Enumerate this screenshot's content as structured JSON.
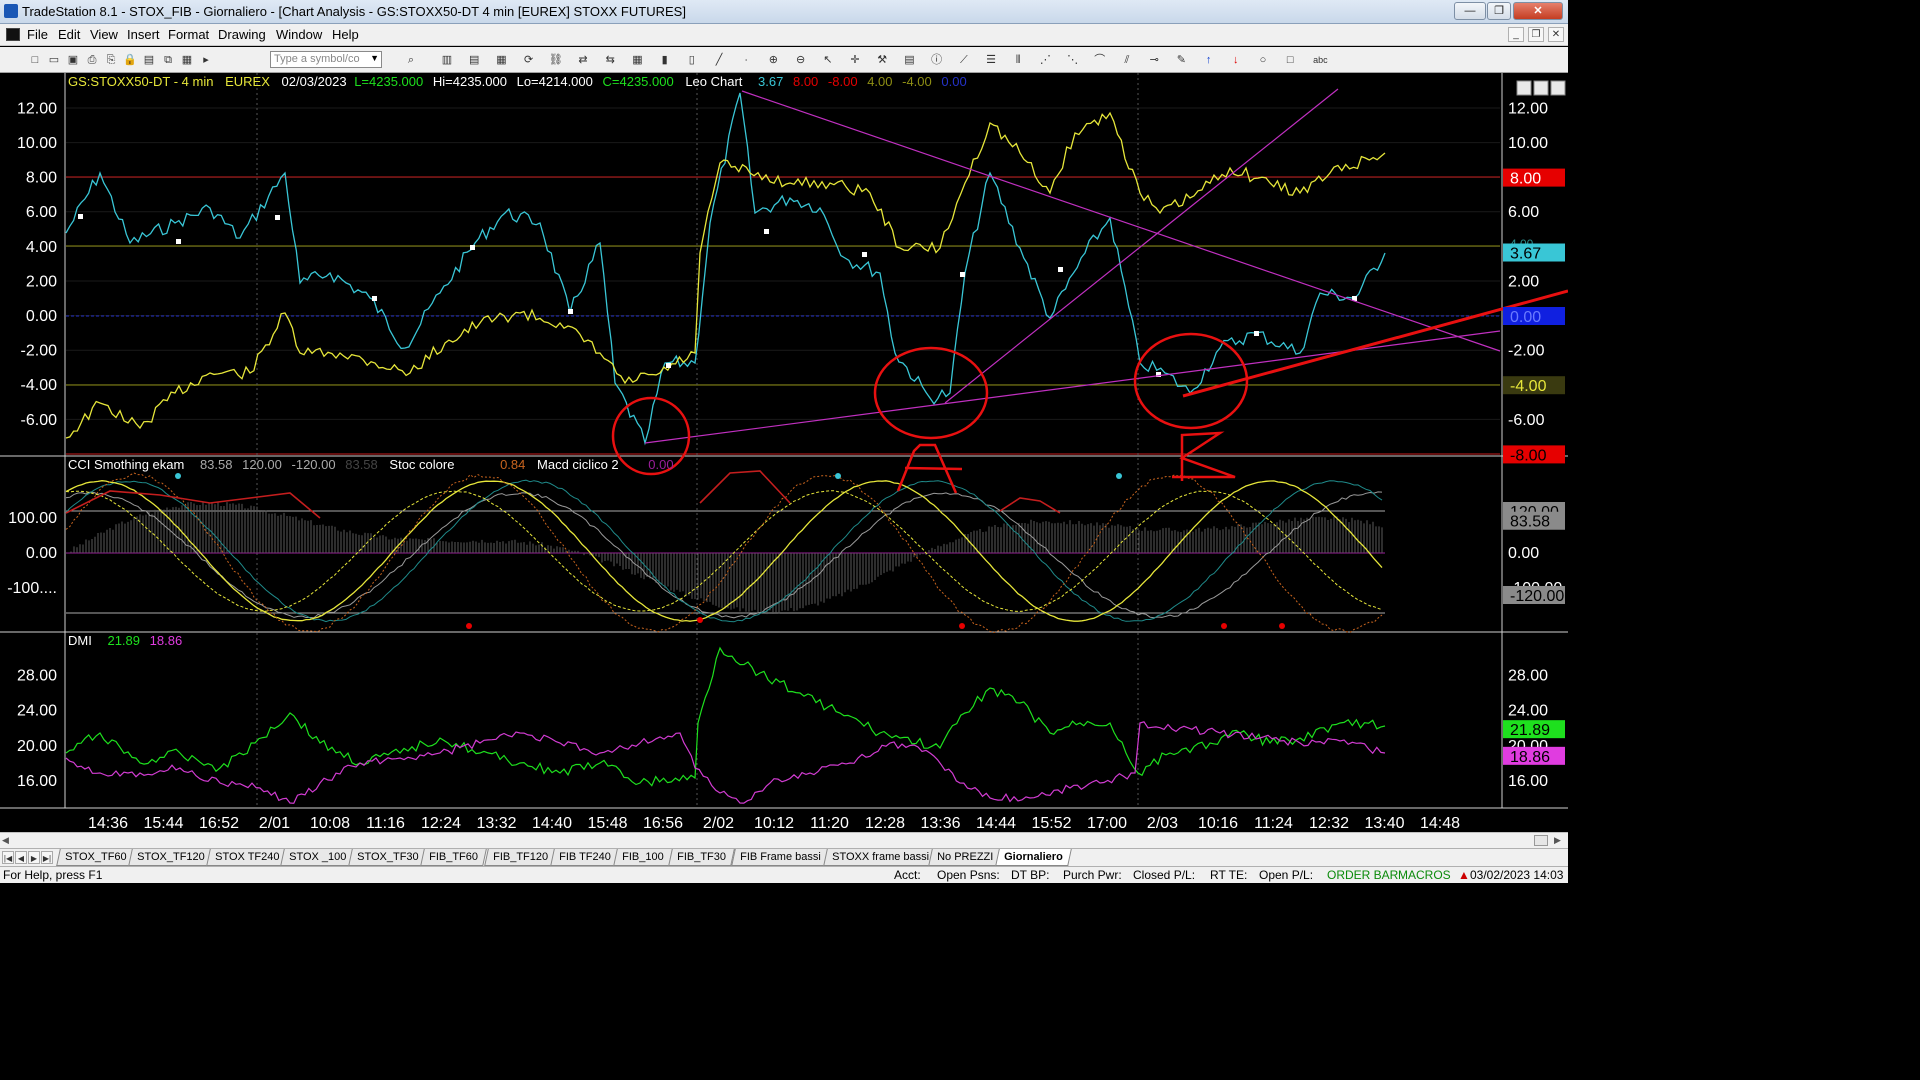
{
  "window": {
    "title": "TradeStation 8.1 - STOX_FIB - Giornaliero - [Chart Analysis - GS:STOXX50-DT  4 min  [EUREX] STOXX FUTURES]",
    "buttons": {
      "minimize": "—",
      "maximize": "❐",
      "close": "✕"
    }
  },
  "menu": {
    "items": [
      "File",
      "Edit",
      "View",
      "Insert",
      "Format",
      "Drawing",
      "Window",
      "Help"
    ],
    "mdi_buttons": [
      "_",
      "❐",
      "✕"
    ]
  },
  "toolbar": {
    "symbol_placeholder": "Type a symbol/co",
    "icons": [
      "new-icon",
      "open-icon",
      "save-icon",
      "print-icon",
      "print-preview-icon",
      "lock-icon",
      "folder-icon",
      "copy-icon",
      "chart-icon",
      "play-icon",
      "search-icon",
      "window-1-icon",
      "window-2-icon",
      "window-3-icon",
      "refresh-icon",
      "link-icon",
      "pair-icon",
      "arrow-icon",
      "table-icon",
      "bar-icon",
      "candle-icon",
      "line-icon",
      "point-icon",
      "zoom-in-icon",
      "zoom-out-icon",
      "cursor-icon",
      "crosshair-icon",
      "tools-icon",
      "calc-icon",
      "info-icon",
      "trendline-icon",
      "hline-icon",
      "vline-icon",
      "fib-icon",
      "pitch-icon",
      "gann-icon",
      "channel-icon",
      "ruler-icon",
      "pen-icon",
      "arrow-up-icon",
      "arrow-down-icon",
      "ellipse-icon",
      "rectangle-icon",
      "text-icon"
    ]
  },
  "chart": {
    "header": {
      "symbol": "GS:STOXX50-DT - 4 min",
      "exchange": "EUREX",
      "date": "02/03/2023",
      "last": "L=4235.000",
      "high": "Hi=4235.000",
      "low": "Lo=4214.000",
      "close": "C=4235.000",
      "study": "Leo Chart",
      "v1": "3.67",
      "v2": "8.00",
      "v3": "-8.00",
      "v4": "4.00",
      "v5": "-4.00",
      "v6": "0.00"
    },
    "pane2_header": {
      "name": "CCI Smothing ekam",
      "v1": "83.58",
      "v2": "120.00",
      "v3": "-120.00",
      "v4": "83.58",
      "name2": "Stoc colore",
      "v5": "0.84",
      "name3": "Macd ciclico 2",
      "v6": "0.00"
    },
    "pane3_header": {
      "name": "DMI",
      "v1": "21.89",
      "v2": "18.86"
    },
    "axis1_ticks": [
      "12.00",
      "10.00",
      "8.00",
      "6.00",
      "4.00",
      "2.00",
      "0.00",
      "-2.00",
      "-4.00",
      "-6.00"
    ],
    "axis1_right_ticks": [
      "12.00",
      "10.00",
      "6.00",
      "2.00",
      "-2.00",
      "-6.00"
    ],
    "axis1_badges": {
      "red_top": "8.00",
      "cyan": "3.67",
      "blue": "0.00",
      "olive": "-4.00",
      "red_bottom": "-8.00",
      "ghost": "4.00"
    },
    "axis2_ticks": [
      "100.00",
      "0.00",
      "-100...."
    ],
    "axis2_right_ticks": [
      "0.00",
      "-100.00"
    ],
    "axis2_badges": {
      "grey1": "120.00",
      "grey2": "83.58",
      "grey3": "-120.00"
    },
    "axis3_ticks": [
      "28.00",
      "24.00",
      "20.00",
      "16.00"
    ],
    "axis3_right_ticks": [
      "28.00",
      "24.00",
      "16.00",
      "20.00"
    ],
    "axis3_badges": {
      "green": "21.89",
      "magenta": "18.86"
    },
    "time_ticks": [
      "14:36",
      "15:44",
      "16:52",
      "2/01",
      "10:08",
      "11:16",
      "12:24",
      "13:32",
      "14:40",
      "15:48",
      "16:56",
      "2/02",
      "10:12",
      "11:20",
      "12:28",
      "13:36",
      "14:44",
      "15:52",
      "17:00",
      "2/03",
      "10:16",
      "11:24",
      "12:32",
      "13:40",
      "14:48"
    ],
    "colors": {
      "cyan": "#39c6d6",
      "yellow": "#e6e63a",
      "red": "#e60000",
      "olive": "#a3a31b",
      "magenta": "#d23cd2",
      "green": "#1ee01e",
      "orange": "#c8641e",
      "grey": "#9a9a9a"
    }
  },
  "tabs": [
    "STOX_TF60",
    "STOX_TF120",
    "STOX TF240",
    "STOX _100",
    "STOX_TF30",
    "FIB_TF60",
    "FIB_TF120",
    "FIB TF240",
    "FIB_100",
    "FIB_TF30",
    "FIB Frame bassi",
    "STOXX frame bassi",
    "No PREZZI",
    "Giornaliero"
  ],
  "status": {
    "help": "For Help, press F1",
    "acct": "Acct:",
    "open_psns": "Open Psns:",
    "dt_bp": "DT BP:",
    "purch_pwr": "Purch Pwr:",
    "closed_pl": "Closed P/L:",
    "rt_te": "RT TE:",
    "open_pl": "Open P/L:",
    "order_bar": "ORDER BAR",
    "macros": "MACROS",
    "datetime": "03/02/2023 14:03"
  }
}
